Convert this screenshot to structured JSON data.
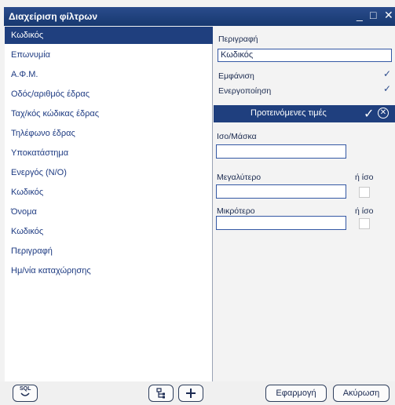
{
  "window": {
    "title": "Διαχείριση φίλτρων",
    "minimize_glyph": "_",
    "maximize_glyph": "□",
    "close_glyph": "✕"
  },
  "fields": [
    {
      "label": "Κωδικός",
      "selected": true
    },
    {
      "label": "Επωνυμία"
    },
    {
      "label": "Α.Φ.Μ."
    },
    {
      "label": "Οδός/αριθμός έδρας"
    },
    {
      "label": "Ταχ/κός κώδικας έδρας"
    },
    {
      "label": "Τηλέφωνο έδρας"
    },
    {
      "label": "Υποκατάστημα"
    },
    {
      "label": "Ενεργός (Ν/Ο)"
    },
    {
      "label": "Κωδικός"
    },
    {
      "label": "Όνομα"
    },
    {
      "label": "Κωδικός"
    },
    {
      "label": "Περιγραφή"
    },
    {
      "label": "Ημ/νία καταχώρησης"
    }
  ],
  "details": {
    "description_label": "Περιγραφή",
    "description_value": "Κωδικός",
    "visibility_label": "Εμφάνιση",
    "visibility_checked": true,
    "active_label": "Ενεργοποίηση",
    "active_checked": true
  },
  "suggested": {
    "title": "Προτεινόμενες τιμές",
    "ok_glyph": "✓",
    "close_glyph": "✕"
  },
  "criteria": {
    "equal_label": "Ισο/Μάσκα",
    "equal_value": "",
    "greater_label": "Μεγαλύτερο",
    "greater_value": "",
    "greater_or_equal_label": "ή ίσο",
    "less_label": "Μικρότερο",
    "less_value": "",
    "less_or_equal_label": "ή ίσο"
  },
  "buttons": {
    "sql": "SQL",
    "apply": "Εφαρμογή",
    "cancel": "Ακύρωση"
  }
}
